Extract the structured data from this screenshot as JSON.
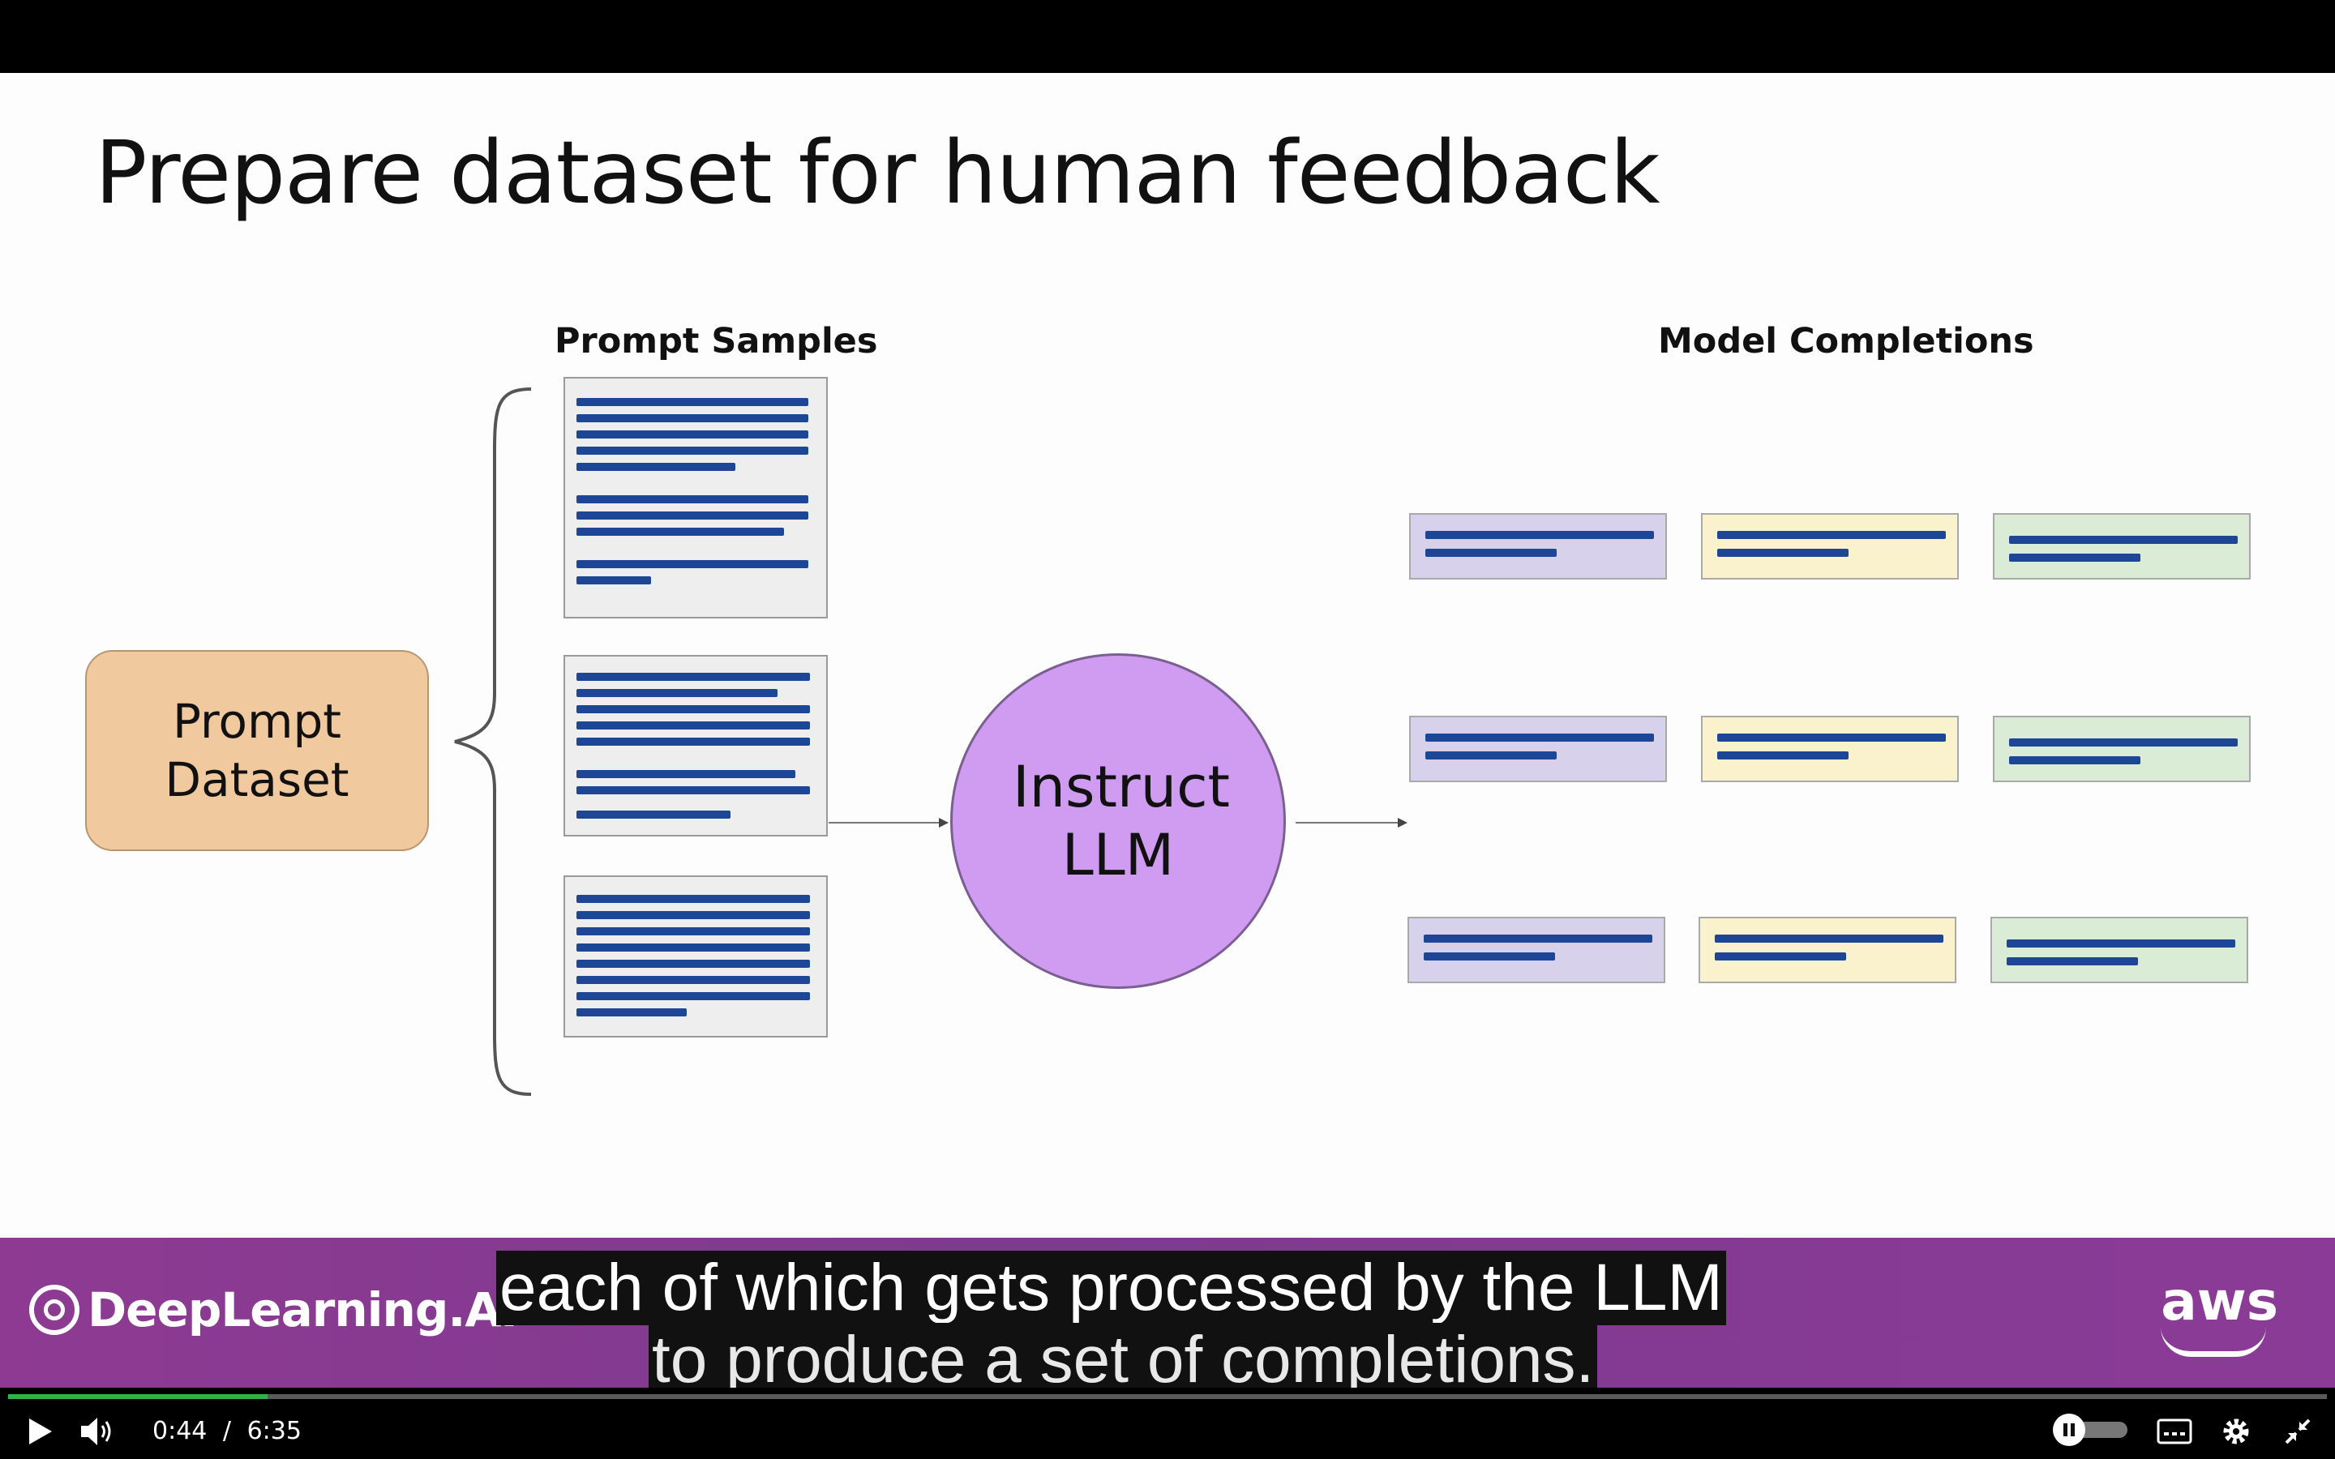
{
  "slide": {
    "title": "Prepare dataset for human feedback",
    "prompt_samples_label": "Prompt Samples",
    "model_completions_label": "Model Completions",
    "prompt_dataset_label": "Prompt Dataset",
    "llm_label": "Instruct LLM",
    "colors": {
      "prompt_dataset": "#f1c99e",
      "llm": "#cf9cf2",
      "completion_1": "#d7d1ec",
      "completion_2": "#faf1cd",
      "completion_3": "#dbecd6",
      "text_lines": "#1d4796"
    }
  },
  "banner": {
    "brand_left": "DeepLearning.AI",
    "brand_right": "aws"
  },
  "captions": {
    "line1": "each of which gets processed by the LLM",
    "line2": "to produce a set of completions."
  },
  "player": {
    "current_time": "0:44",
    "separator": "/",
    "duration": "6:35",
    "progress": 0.112,
    "icons": [
      "play-icon",
      "volume-icon",
      "autoplay-toggle-icon",
      "captions-icon",
      "settings-icon",
      "exit-fullscreen-icon"
    ]
  }
}
